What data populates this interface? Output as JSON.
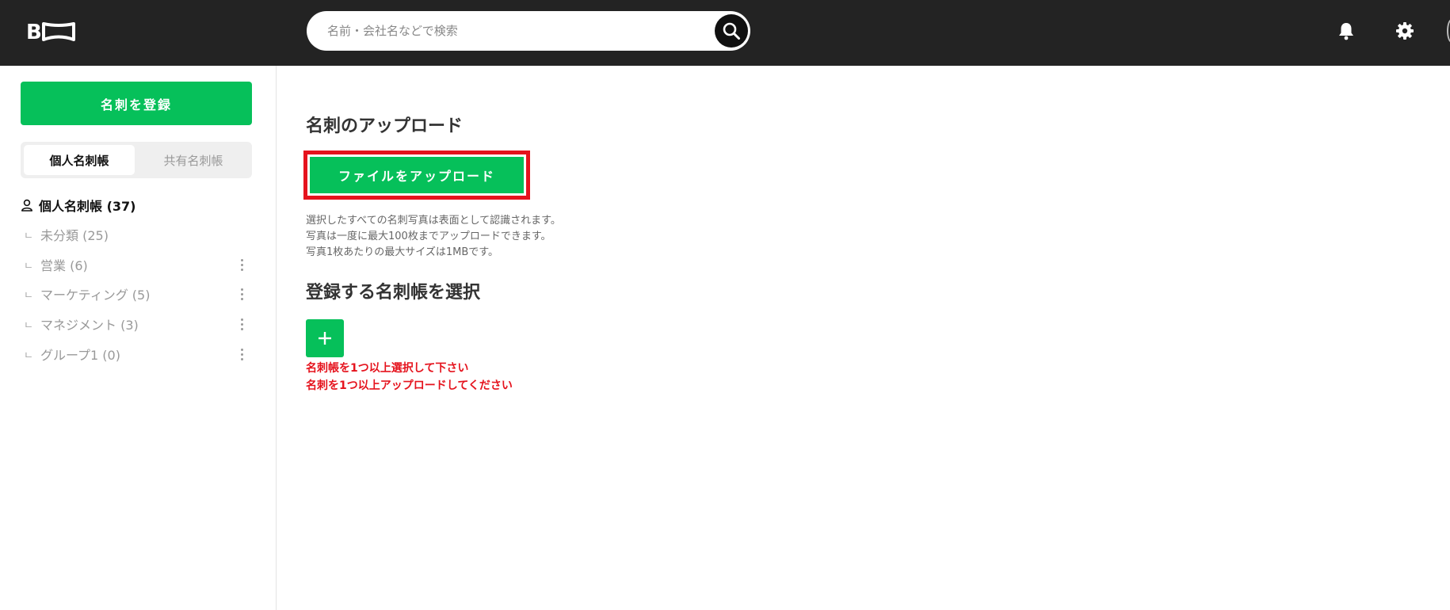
{
  "header": {
    "logo_alt": "BC",
    "search_placeholder": "名前・会社名などで検索"
  },
  "sidebar": {
    "register_label": "名刺を登録",
    "tabs": [
      {
        "label": "個人名刺帳",
        "selected": true
      },
      {
        "label": "共有名刺帳",
        "selected": false
      }
    ],
    "root_label": "個人名刺帳 (37)",
    "items": [
      {
        "label": "未分類 (25)",
        "has_menu": false
      },
      {
        "label": "営業 (6)",
        "has_menu": true
      },
      {
        "label": "マーケティング (5)",
        "has_menu": true
      },
      {
        "label": "マネジメント (3)",
        "has_menu": true
      },
      {
        "label": "グループ1 (0)",
        "has_menu": true
      }
    ]
  },
  "main": {
    "upload_heading": "名刺のアップロード",
    "upload_button": "ファイルをアップロード",
    "notes": [
      "選択したすべての名刺写真は表面として認識されます。",
      "写真は一度に最大100枚までアップロードできます。",
      "写真1枚あたりの最大サイズは1MBです。"
    ],
    "select_heading": "登録する名刺帳を選択",
    "errors": [
      "名刺帳を1つ以上選択して下さい",
      "名刺を1つ以上アップロードしてください"
    ]
  },
  "colors": {
    "header_bg": "#232323",
    "accent_green": "#06c05a",
    "error_red": "#e5131d"
  }
}
